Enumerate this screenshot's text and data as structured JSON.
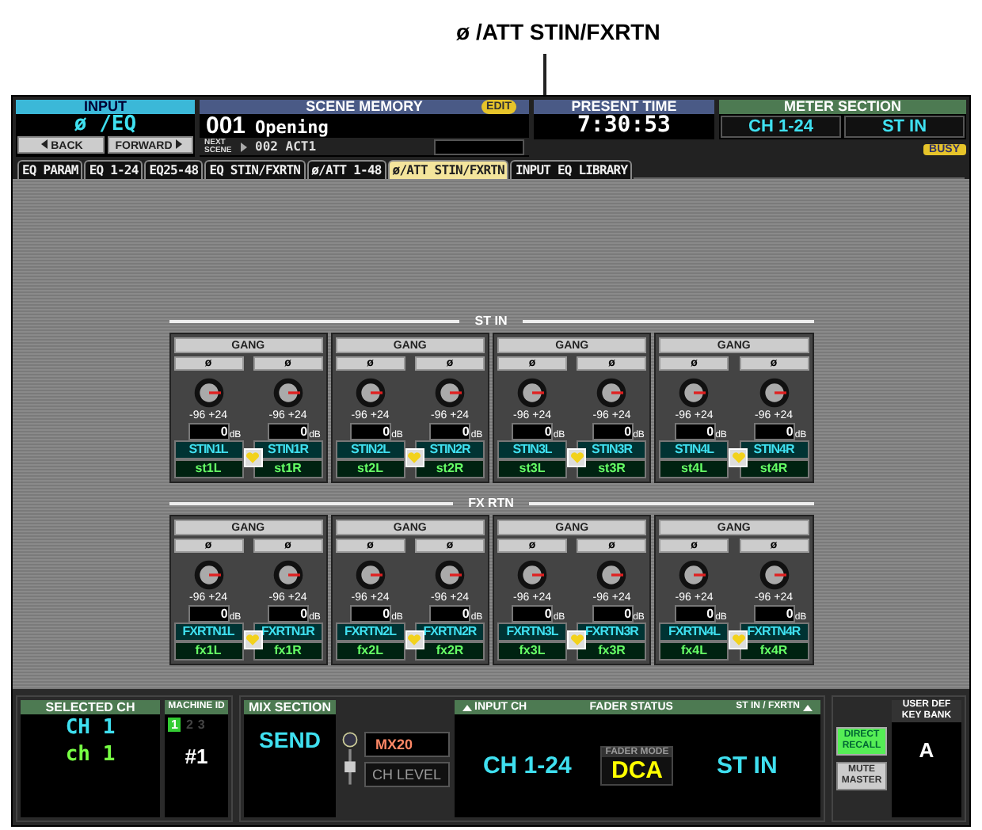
{
  "caption": "ø /ATT STIN/FXRTN",
  "header": {
    "input": {
      "title": "INPUT",
      "value": "ø /EQ"
    },
    "back": "BACK",
    "forward": "FORWARD",
    "scene_memory": {
      "title": "SCENE MEMORY",
      "badge": "EDIT",
      "number": "001",
      "name": "Opening",
      "next_label": "NEXT SCENE",
      "next": "002 ACT1"
    },
    "present_time": {
      "title": "PRESENT TIME",
      "value": "7:30:53"
    },
    "meter_section": {
      "title": "METER SECTION",
      "buttons": [
        "CH 1-24",
        "ST IN"
      ]
    },
    "busy": "BUSY"
  },
  "tabs": [
    {
      "label": "EQ PARAM",
      "selected": false
    },
    {
      "label": "EQ 1-24",
      "selected": false
    },
    {
      "label": "EQ25-48",
      "selected": false
    },
    {
      "label": "EQ STIN/FXRTN",
      "selected": false
    },
    {
      "label": "ø/ATT 1-48",
      "selected": false
    },
    {
      "label": "ø/ATT STIN/FXRTN",
      "selected": true
    },
    {
      "label": "INPUT EQ LIBRARY",
      "selected": false
    }
  ],
  "sections": [
    {
      "title": "ST IN",
      "groups": [
        {
          "gang": "GANG",
          "channels": [
            {
              "phase": "ø",
              "scale_min": "-96",
              "scale_max": "+24",
              "value": "0",
              "unit": "dB",
              "name": "STIN1L",
              "short": "st1L"
            },
            {
              "phase": "ø",
              "scale_min": "-96",
              "scale_max": "+24",
              "value": "0",
              "unit": "dB",
              "name": "STIN1R",
              "short": "st1R"
            }
          ]
        },
        {
          "gang": "GANG",
          "channels": [
            {
              "phase": "ø",
              "scale_min": "-96",
              "scale_max": "+24",
              "value": "0",
              "unit": "dB",
              "name": "STIN2L",
              "short": "st2L"
            },
            {
              "phase": "ø",
              "scale_min": "-96",
              "scale_max": "+24",
              "value": "0",
              "unit": "dB",
              "name": "STIN2R",
              "short": "st2R"
            }
          ]
        },
        {
          "gang": "GANG",
          "channels": [
            {
              "phase": "ø",
              "scale_min": "-96",
              "scale_max": "+24",
              "value": "0",
              "unit": "dB",
              "name": "STIN3L",
              "short": "st3L"
            },
            {
              "phase": "ø",
              "scale_min": "-96",
              "scale_max": "+24",
              "value": "0",
              "unit": "dB",
              "name": "STIN3R",
              "short": "st3R"
            }
          ]
        },
        {
          "gang": "GANG",
          "channels": [
            {
              "phase": "ø",
              "scale_min": "-96",
              "scale_max": "+24",
              "value": "0",
              "unit": "dB",
              "name": "STIN4L",
              "short": "st4L"
            },
            {
              "phase": "ø",
              "scale_min": "-96",
              "scale_max": "+24",
              "value": "0",
              "unit": "dB",
              "name": "STIN4R",
              "short": "st4R"
            }
          ]
        }
      ]
    },
    {
      "title": "FX RTN",
      "groups": [
        {
          "gang": "GANG",
          "channels": [
            {
              "phase": "ø",
              "scale_min": "-96",
              "scale_max": "+24",
              "value": "0",
              "unit": "dB",
              "name": "FXRTN1L",
              "short": "fx1L"
            },
            {
              "phase": "ø",
              "scale_min": "-96",
              "scale_max": "+24",
              "value": "0",
              "unit": "dB",
              "name": "FXRTN1R",
              "short": "fx1R"
            }
          ]
        },
        {
          "gang": "GANG",
          "channels": [
            {
              "phase": "ø",
              "scale_min": "-96",
              "scale_max": "+24",
              "value": "0",
              "unit": "dB",
              "name": "FXRTN2L",
              "short": "fx2L"
            },
            {
              "phase": "ø",
              "scale_min": "-96",
              "scale_max": "+24",
              "value": "0",
              "unit": "dB",
              "name": "FXRTN2R",
              "short": "fx2R"
            }
          ]
        },
        {
          "gang": "GANG",
          "channels": [
            {
              "phase": "ø",
              "scale_min": "-96",
              "scale_max": "+24",
              "value": "0",
              "unit": "dB",
              "name": "FXRTN3L",
              "short": "fx3L"
            },
            {
              "phase": "ø",
              "scale_min": "-96",
              "scale_max": "+24",
              "value": "0",
              "unit": "dB",
              "name": "FXRTN3R",
              "short": "fx3R"
            }
          ]
        },
        {
          "gang": "GANG",
          "channels": [
            {
              "phase": "ø",
              "scale_min": "-96",
              "scale_max": "+24",
              "value": "0",
              "unit": "dB",
              "name": "FXRTN4L",
              "short": "fx4L"
            },
            {
              "phase": "ø",
              "scale_min": "-96",
              "scale_max": "+24",
              "value": "0",
              "unit": "dB",
              "name": "FXRTN4R",
              "short": "fx4R"
            }
          ]
        }
      ]
    }
  ],
  "footer": {
    "selected_ch": {
      "title": "SELECTED CH",
      "channel": "CH 1",
      "name": "ch 1"
    },
    "machine_id": {
      "title": "MACHINE ID",
      "ids": [
        {
          "label": "1",
          "selected": true
        },
        {
          "label": "2",
          "selected": false
        },
        {
          "label": "3",
          "selected": false
        }
      ],
      "value": "#1"
    },
    "mix_section": {
      "title": "MIX SECTION",
      "value": "SEND"
    },
    "mix": "MX20",
    "ch_level": "CH LEVEL",
    "input_ch": {
      "title": "INPUT CH",
      "value": "CH 1-24"
    },
    "fader_status": "FADER STATUS",
    "fader_mode": {
      "title": "FADER MODE",
      "value": "DCA"
    },
    "stin_fxrtn": {
      "title": "ST IN / FXRTN",
      "value": "ST IN"
    },
    "direct_recall": "DIRECT RECALL",
    "mute_master": "MUTE MASTER",
    "user_def": {
      "title": "USER DEF KEY BANK",
      "value": "A"
    }
  }
}
